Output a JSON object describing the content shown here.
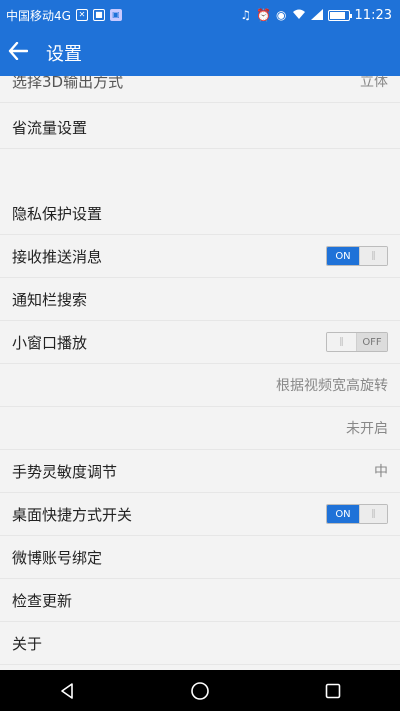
{
  "status_bar": {
    "carrier": "中国移动4G",
    "time": "11:23",
    "icons": [
      "usb-icon",
      "notification-icon",
      "app-icon",
      "headphones-icon",
      "alarm-icon",
      "eye-icon",
      "wifi-icon",
      "signal-icon",
      "battery-icon"
    ]
  },
  "app_bar": {
    "title": "设置",
    "back_icon": "arrow-left-icon"
  },
  "settings": {
    "partial_top_label": "选择3D输出方式",
    "partial_top_value": "立体",
    "data_saving": "省流量设置",
    "privacy": "隐私保护设置",
    "push_messages": {
      "label": "接收推送消息",
      "toggle": "ON"
    },
    "notif_search": "通知栏搜索",
    "mini_window": {
      "label": "小窗口播放",
      "toggle": "OFF"
    },
    "rotate_value": "根据视频宽高旋转",
    "unopened_value": "未开启",
    "gesture_sensitivity": {
      "label": "手势灵敏度调节",
      "value": "中"
    },
    "desktop_shortcut": {
      "label": "桌面快捷方式开关",
      "toggle": "ON"
    },
    "weibo_binding": "微博账号绑定",
    "check_update": "检查更新",
    "about": "关于"
  },
  "nav_bar": {
    "icons": [
      "back-triangle-icon",
      "home-circle-icon",
      "recents-square-icon"
    ]
  },
  "colors": {
    "primary": "#1f72d8",
    "background": "#f3f3f3",
    "nav": "#000000"
  }
}
